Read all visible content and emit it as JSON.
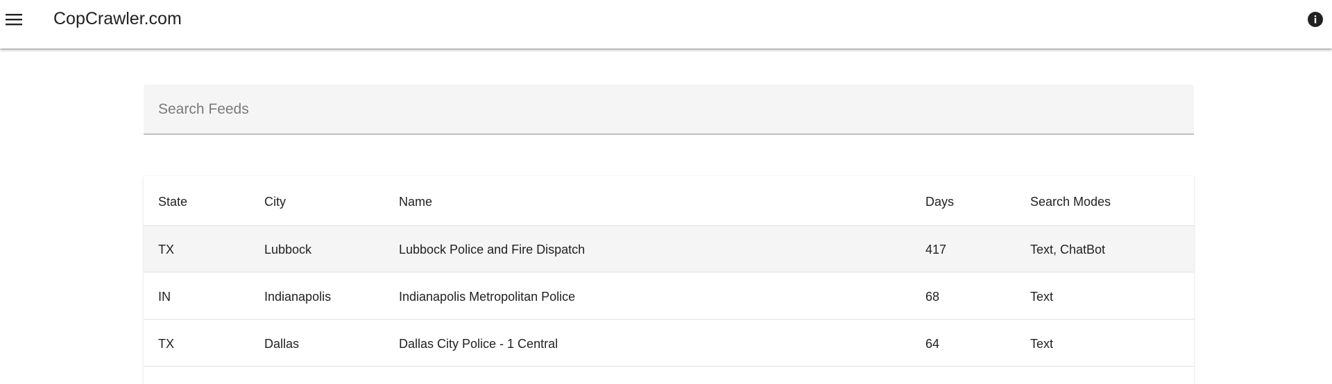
{
  "app_bar": {
    "title": "CopCrawler.com",
    "menu_icon": "hamburger-menu-icon",
    "info_icon": "info-icon"
  },
  "search": {
    "placeholder": "Search Feeds",
    "value": ""
  },
  "table": {
    "headers": {
      "state": "State",
      "city": "City",
      "name": "Name",
      "days": "Days",
      "modes": "Search Modes"
    },
    "rows": [
      {
        "state": "TX",
        "city": "Lubbock",
        "name": "Lubbock Police and Fire Dispatch",
        "days": "417",
        "modes": "Text, ChatBot"
      },
      {
        "state": "IN",
        "city": "Indianapolis",
        "name": "Indianapolis Metropolitan Police",
        "days": "68",
        "modes": "Text"
      },
      {
        "state": "TX",
        "city": "Dallas",
        "name": "Dallas City Police - 1 Central",
        "days": "64",
        "modes": "Text"
      }
    ]
  },
  "colors": {
    "appbar_bg": "#ffffff",
    "text": "#212121",
    "search_bg": "#f5f5f5",
    "row_highlight": "#f5f5f5",
    "divider": "#e0e0e0"
  }
}
